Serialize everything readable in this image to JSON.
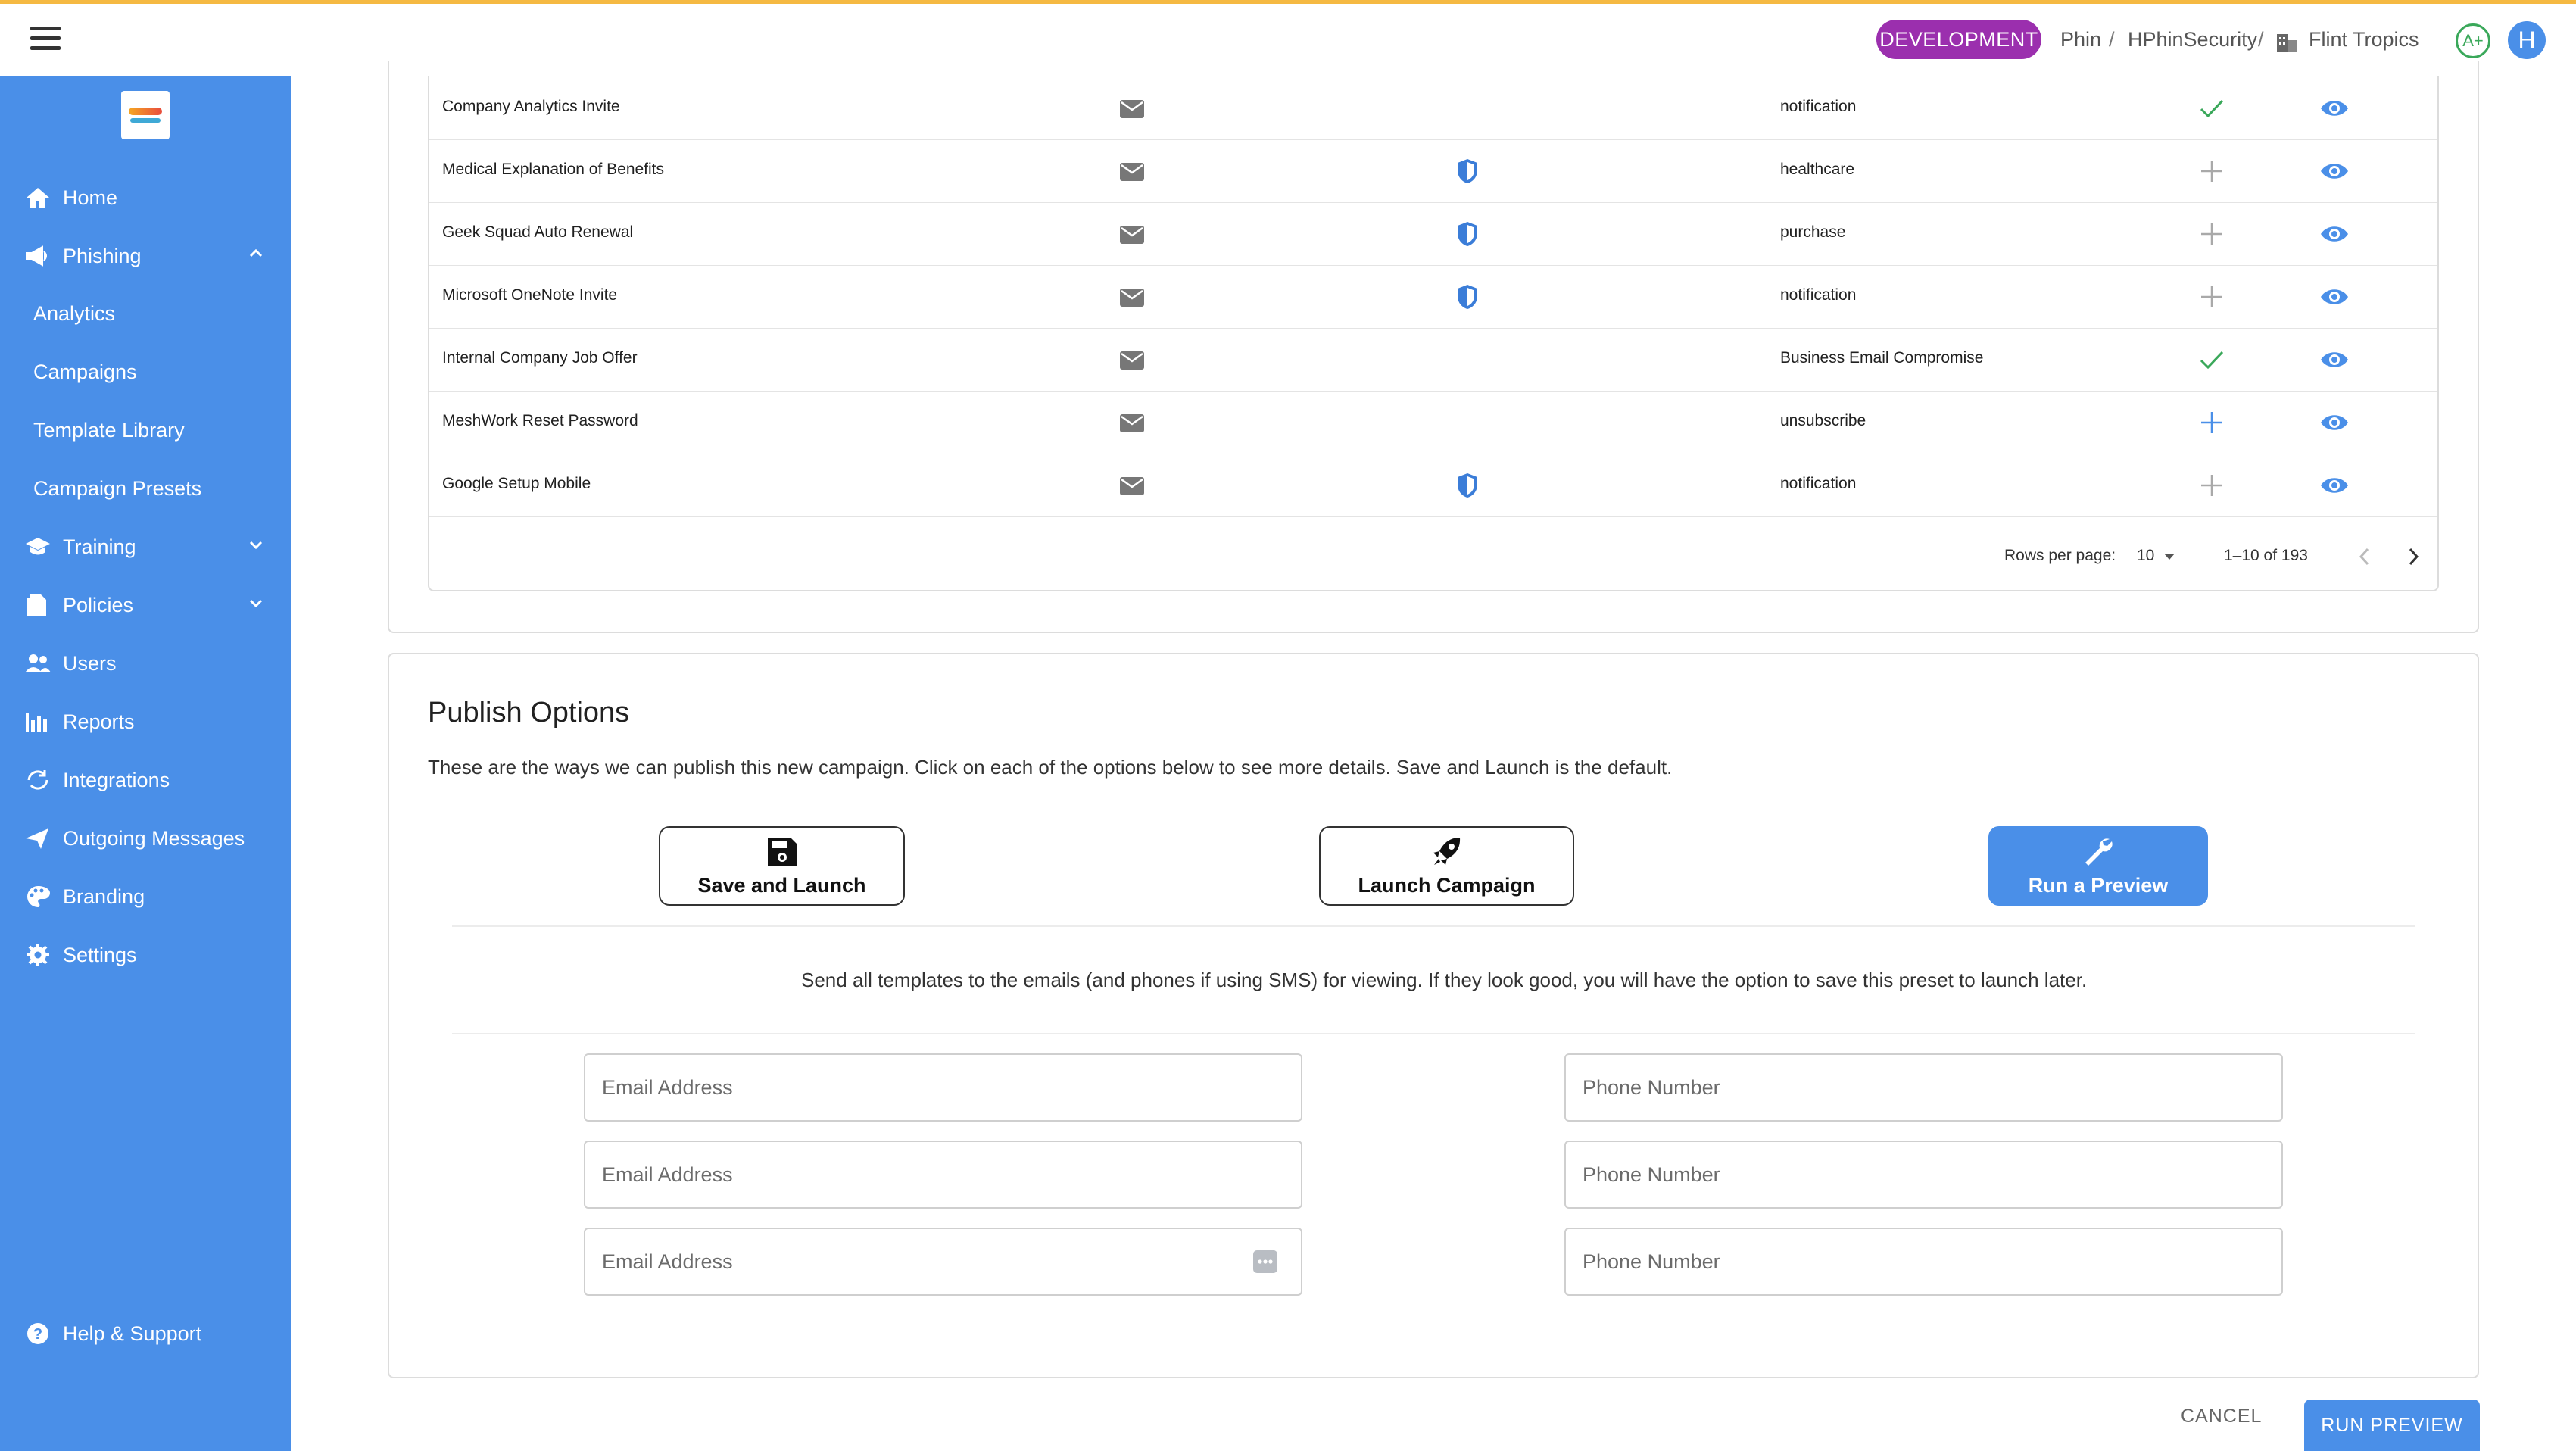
{
  "topbar": {
    "environment": "DEVELOPMENT",
    "breadcrumb": [
      "Phin",
      "HPhinSecurity",
      "Flint Tropics"
    ],
    "separator": "/",
    "grade": "A+",
    "user_initial": "H"
  },
  "sidebar": {
    "items": [
      {
        "label": "Home",
        "icon": "home-icon"
      },
      {
        "label": "Phishing",
        "icon": "megaphone-icon",
        "expanded": true
      },
      {
        "label": "Analytics"
      },
      {
        "label": "Campaigns"
      },
      {
        "label": "Template Library"
      },
      {
        "label": "Campaign Presets"
      },
      {
        "label": "Training",
        "icon": "school-icon"
      },
      {
        "label": "Policies",
        "icon": "policy-icon"
      },
      {
        "label": "Users",
        "icon": "users-icon"
      },
      {
        "label": "Reports",
        "icon": "bar-chart-icon"
      },
      {
        "label": "Integrations",
        "icon": "sync-icon"
      },
      {
        "label": "Outgoing Messages",
        "icon": "send-icon"
      },
      {
        "label": "Branding",
        "icon": "palette-icon"
      },
      {
        "label": "Settings",
        "icon": "gear-icon"
      }
    ],
    "help": "Help & Support"
  },
  "templates": {
    "rows": [
      {
        "name": "Company Analytics Invite",
        "tag": "notification",
        "shield": false,
        "status": "check"
      },
      {
        "name": "Medical Explanation of Benefits",
        "tag": "healthcare",
        "shield": true,
        "status": "plus"
      },
      {
        "name": "Geek Squad Auto Renewal",
        "tag": "purchase",
        "shield": true,
        "status": "plus"
      },
      {
        "name": "Microsoft OneNote Invite",
        "tag": "notification",
        "shield": true,
        "status": "plus"
      },
      {
        "name": "Internal Company Job Offer",
        "tag": "Business Email Compromise",
        "shield": false,
        "status": "check"
      },
      {
        "name": "MeshWork Reset Password",
        "tag": "unsubscribe",
        "shield": false,
        "status": "plus-active"
      },
      {
        "name": "Google Setup Mobile",
        "tag": "notification",
        "shield": true,
        "status": "plus"
      }
    ],
    "pagination": {
      "rows_per_page_label": "Rows per page:",
      "rows_per_page": "10",
      "range": "1–10 of 193"
    }
  },
  "publish": {
    "title": "Publish Options",
    "description": "These are the ways we can publish this new campaign. Click on each of the options below to see more details. Save and Launch is the default.",
    "options": [
      {
        "label": "Save and Launch",
        "icon": "floppy-disk-icon",
        "active": false
      },
      {
        "label": "Launch Campaign",
        "icon": "rocket-icon",
        "active": false
      },
      {
        "label": "Run a Preview",
        "icon": "wrench-icon",
        "active": true
      }
    ],
    "preview_text": "Send all templates to the emails (and phones if using SMS) for viewing. If they look good, you will have the option to save this preset to launch later.",
    "email_placeholder": "Email Address",
    "phone_placeholder": "Phone Number"
  },
  "actions": {
    "cancel": "CANCEL",
    "run_preview": "RUN PREVIEW"
  },
  "colors": {
    "primary": "#4a8fe8",
    "env_badge": "#9b2fae",
    "top_accent": "#f5b942",
    "check_green": "#3aa85a"
  }
}
